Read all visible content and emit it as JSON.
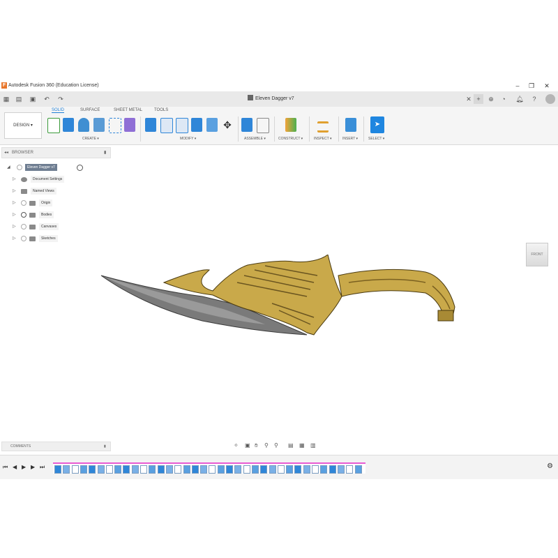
{
  "window": {
    "title": "Autodesk Fusion 360 (Education License)",
    "controls": [
      "–",
      "❐",
      "✕"
    ]
  },
  "tabbar": {
    "document_title": "Eleven Dagger v7",
    "close": "✕",
    "new_tab": "+"
  },
  "toolbar": {
    "design_button": "DESIGN ▾",
    "workspace_tabs": [
      "SOLID",
      "SURFACE",
      "SHEET METAL",
      "TOOLS"
    ],
    "groups": [
      "CREATE ▾",
      "MODIFY ▾",
      "ASSEMBLE ▾",
      "CONSTRUCT ▾",
      "INSPECT ▾",
      "INSERT ▾",
      "SELECT ▾"
    ]
  },
  "browser": {
    "header": "BROWSER",
    "root": "Eleven Dagger v7",
    "items": [
      "Document Settings",
      "Named Views",
      "Origin",
      "Bodies",
      "Canvases",
      "Sketches"
    ]
  },
  "viewcube": {
    "label": "FRONT"
  },
  "comments": {
    "header": "COMMENTS"
  },
  "colors": {
    "accent": "#1f7fd6",
    "timeline_marker": "#e85bd2",
    "blade": "#7a7a7a",
    "gold": "#c9a94a"
  }
}
